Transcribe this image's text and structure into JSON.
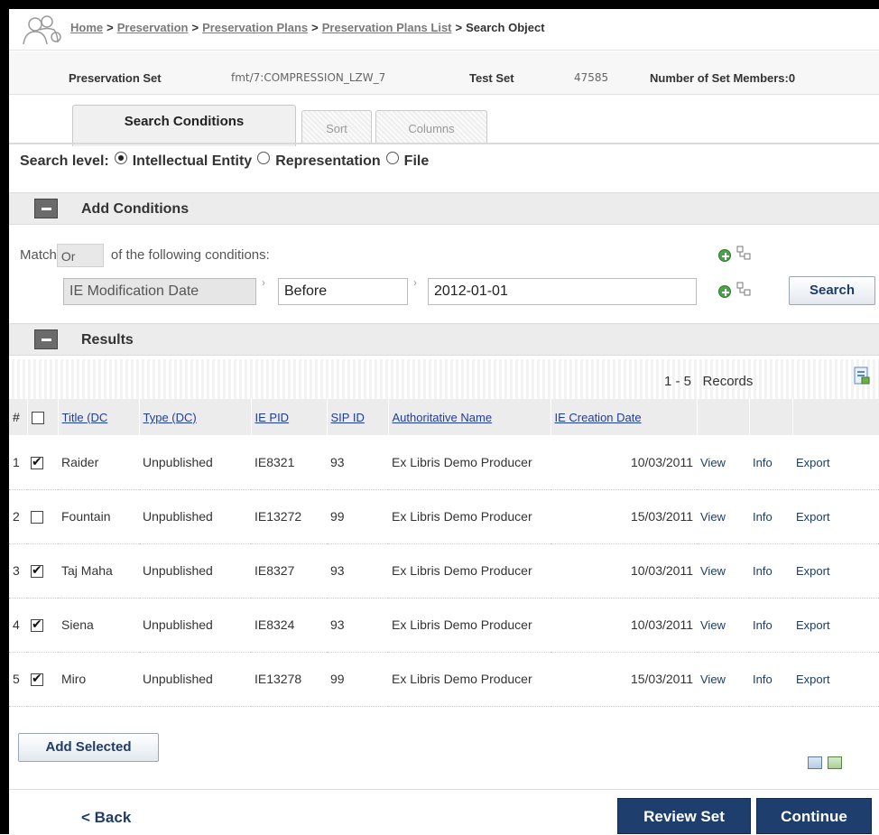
{
  "breadcrumb": {
    "items": [
      "Home",
      "Preservation",
      "Preservation Plans",
      "Preservation Plans List"
    ],
    "separator": ">",
    "current": "Search Object"
  },
  "info": {
    "set_label": "Preservation Set",
    "set_value": "fmt/7:COMPRESSION_LZW_7",
    "test_label": "Test Set",
    "test_value": "47585",
    "members": "Number of Set Members:0"
  },
  "tabs": [
    {
      "label": "Search Conditions",
      "active": true
    },
    {
      "label": "Sort",
      "active": false
    },
    {
      "label": "Columns",
      "active": false
    }
  ],
  "search_level": {
    "label": "Search level:",
    "options": [
      {
        "label": "Intellectual Entity",
        "selected": true
      },
      {
        "label": "Representation",
        "selected": false
      },
      {
        "label": "File",
        "selected": false
      }
    ]
  },
  "conditions": {
    "header": "Add Conditions",
    "match_prefix": "Match",
    "match_value": "Or",
    "match_suffix": "of the following conditions:",
    "field": "IE Modification Date",
    "operator": "Before",
    "value": "2012-01-01",
    "search_label": "Search"
  },
  "results": {
    "header": "Results",
    "pager_range": "1 - 5",
    "pager_label": "Records",
    "columns": [
      "#",
      "",
      "Title (DC",
      "Type (DC)",
      "IE PID",
      "SIP ID",
      "Authoritative Name",
      "IE Creation Date",
      "",
      "",
      ""
    ],
    "rows": [
      {
        "num": "1",
        "checked": true,
        "title": "Raider",
        "type": "Unpublished",
        "pid": "IE8321",
        "sip": "93",
        "auth": "Ex Libris Demo Producer",
        "date": "10/03/2011",
        "view": "View",
        "info": "Info",
        "export": "Export"
      },
      {
        "num": "2",
        "checked": false,
        "title": "Fountain",
        "type": "Unpublished",
        "pid": "IE13272",
        "sip": "99",
        "auth": "Ex Libris Demo Producer",
        "date": "15/03/2011",
        "view": "View",
        "info": "Info",
        "export": "Export"
      },
      {
        "num": "3",
        "checked": true,
        "title": "Taj Maha",
        "type": "Unpublished",
        "pid": "IE8327",
        "sip": "93",
        "auth": "Ex Libris Demo Producer",
        "date": "10/03/2011",
        "view": "View",
        "info": "Info",
        "export": "Export"
      },
      {
        "num": "4",
        "checked": true,
        "title": "Siena",
        "type": "Unpublished",
        "pid": "IE8324",
        "sip": "93",
        "auth": "Ex Libris Demo Producer",
        "date": "10/03/2011",
        "view": "View",
        "info": "Info",
        "export": "Export"
      },
      {
        "num": "5",
        "checked": true,
        "title": "Miro",
        "type": "Unpublished",
        "pid": "IE13278",
        "sip": "99",
        "auth": "Ex Libris Demo Producer",
        "date": "15/03/2011",
        "view": "View",
        "info": "Info",
        "export": "Export"
      }
    ]
  },
  "footer": {
    "add_selected": "Add Selected",
    "back": "< Back",
    "review_set": "Review Set",
    "continue": "Continue"
  },
  "colors": {
    "primary_button": "#1e3f6e",
    "link": "#1f3d99",
    "header_bg": "#ececec"
  }
}
